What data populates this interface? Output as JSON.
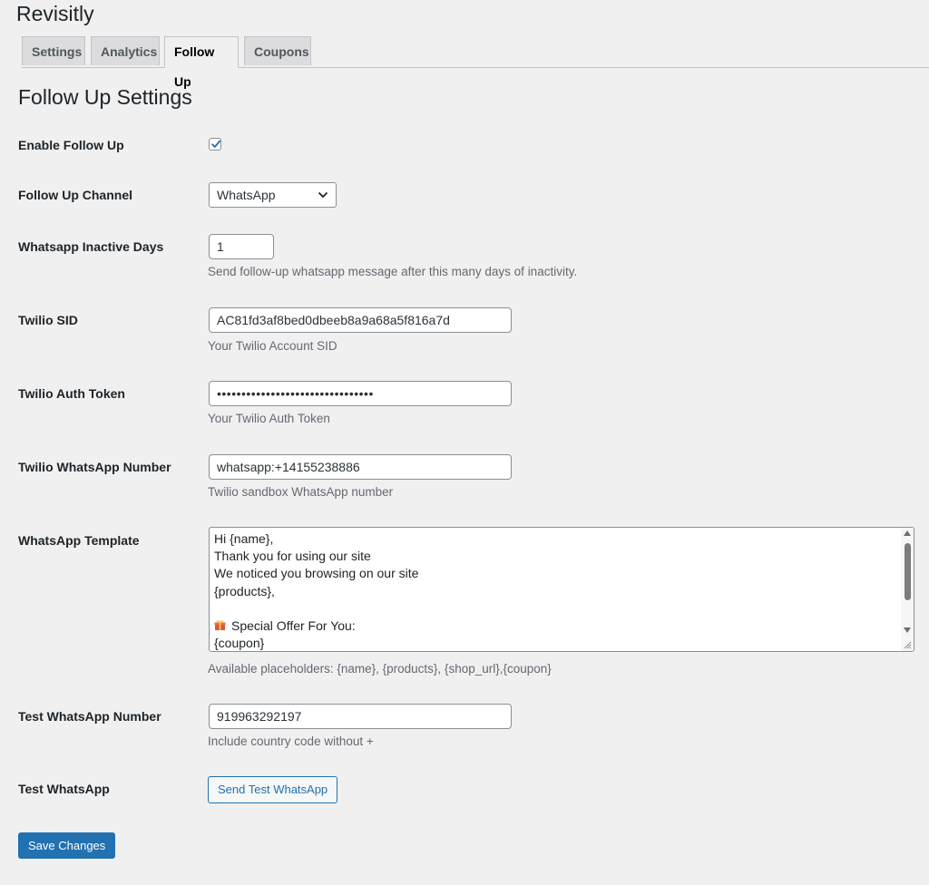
{
  "app": {
    "title": "Revisitly"
  },
  "tabs": [
    {
      "label": "Settings",
      "active": false
    },
    {
      "label": "Analytics",
      "active": false
    },
    {
      "label": "Follow Up",
      "active": true
    },
    {
      "label": "Coupons",
      "active": false
    }
  ],
  "page": {
    "title": "Follow Up Settings"
  },
  "form": {
    "enable_follow_up": {
      "label": "Enable Follow Up",
      "checked": true
    },
    "channel": {
      "label": "Follow Up Channel",
      "value": "WhatsApp"
    },
    "inactive_days": {
      "label": "Whatsapp Inactive Days",
      "value": "1",
      "description": "Send follow-up whatsapp message after this many days of inactivity."
    },
    "twilio_sid": {
      "label": "Twilio SID",
      "value": "AC81fd3af8bed0dbeeb8a9a68a5f816a7d",
      "description": "Your Twilio Account SID"
    },
    "twilio_auth_token": {
      "label": "Twilio Auth Token",
      "value": "••••••••••••••••••••••••••••••••",
      "description": "Your Twilio Auth Token"
    },
    "twilio_whatsapp_number": {
      "label": "Twilio WhatsApp Number",
      "value": "whatsapp:+14155238886",
      "description": "Twilio sandbox WhatsApp number"
    },
    "whatsapp_template": {
      "label": "WhatsApp Template",
      "lines": [
        "Hi {name},",
        "Thank you for using our site",
        "We noticed you browsing on our site",
        "{products},",
        "",
        "Special Offer For You:",
        "{coupon}"
      ],
      "description": "Available placeholders: {name}, {products}, {shop_url},{coupon}"
    },
    "test_whatsapp_number": {
      "label": "Test WhatsApp Number",
      "value": "919963292197",
      "description": "Include country code without +"
    },
    "test_whatsapp": {
      "label": "Test WhatsApp",
      "button_label": "Send Test WhatsApp"
    }
  },
  "footer": {
    "save_label": "Save Changes"
  },
  "colors": {
    "accent": "#2271b1",
    "background": "#f0f0f1",
    "text": "#1d2327",
    "muted": "#646970"
  }
}
